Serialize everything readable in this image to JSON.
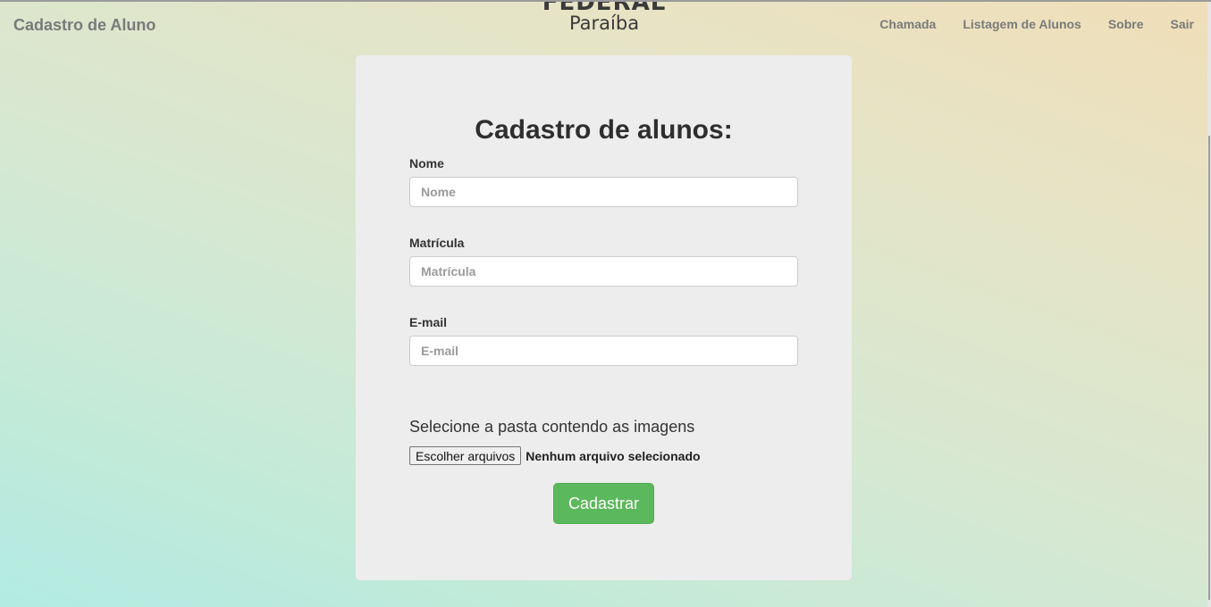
{
  "navbar": {
    "brand": "Cadastro de Aluno",
    "logo_text_top": "FEDERAL",
    "logo_text_sub": "Paraíba",
    "links": [
      "Chamada",
      "Listagem de Alunos",
      "Sobre",
      "Sair"
    ]
  },
  "form": {
    "title": "Cadastro de alunos:",
    "fields": [
      {
        "label": "Nome",
        "placeholder": "Nome",
        "value": ""
      },
      {
        "label": "Matrícula",
        "placeholder": "Matrícula",
        "value": ""
      },
      {
        "label": "E-mail",
        "placeholder": "E-mail",
        "value": ""
      }
    ],
    "folder_label": "Selecione a pasta contendo as imagens",
    "file_button": "Escolher arquivos",
    "file_status": "Nenhum arquivo selecionado",
    "submit": "Cadastrar"
  },
  "colors": {
    "submit": "#5cb85c",
    "card": "#ededed",
    "nav_text": "#7a7a7a"
  }
}
